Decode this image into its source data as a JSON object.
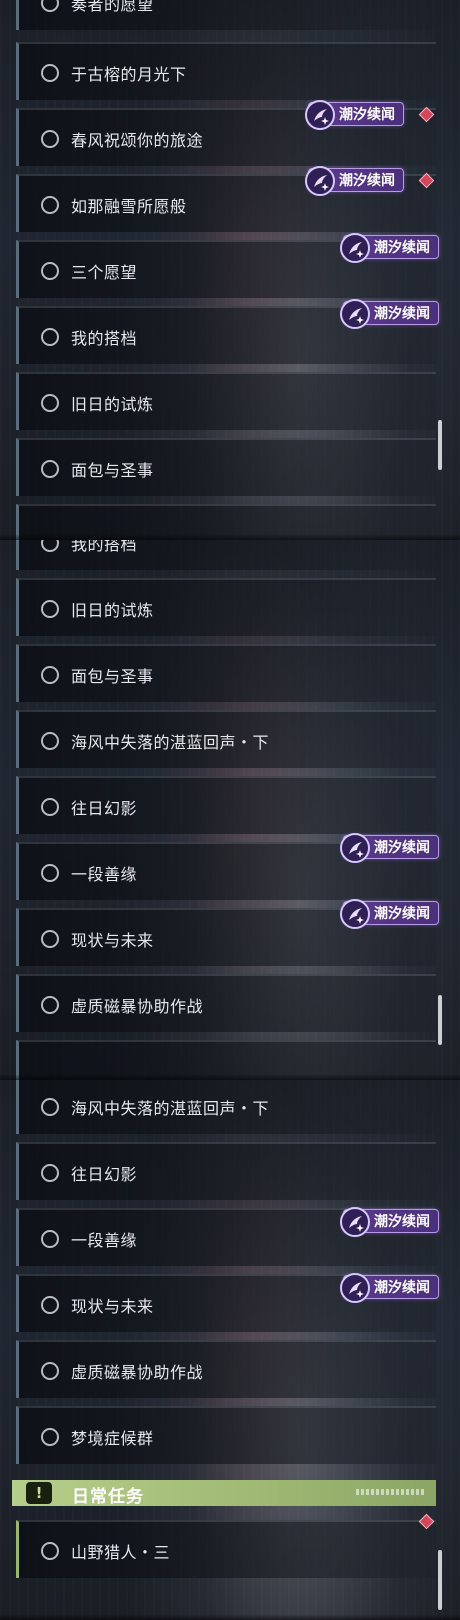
{
  "badge_text": "潮汐续闻",
  "colors": {
    "badge_bg": "#4a2f7a",
    "alert_diamond": "#d4465a",
    "daily_section": "#b5cf8a",
    "row_accent": "#5b6d7c"
  },
  "icons": [
    "circle-status-icon",
    "tide-story-icon",
    "alert-diamond-icon",
    "exclamation-icon"
  ],
  "panel1": {
    "items": [
      {
        "label": "奏者的愿望"
      },
      {
        "label": "于古榕的月光下"
      },
      {
        "label": "春风祝颂你的旅途"
      },
      {
        "label": "如那融雪所愿般"
      },
      {
        "label": "三个愿望"
      },
      {
        "label": "我的搭档"
      },
      {
        "label": "旧日的试炼"
      },
      {
        "label": "面包与圣事"
      }
    ]
  },
  "panel2": {
    "items": [
      {
        "label": "我的搭档"
      },
      {
        "label": "旧日的试炼"
      },
      {
        "label": "面包与圣事"
      },
      {
        "label": "海风中失落的湛蓝回声・下"
      },
      {
        "label": "往日幻影"
      },
      {
        "label": "一段善缘"
      },
      {
        "label": "现状与未来"
      },
      {
        "label": "虚质磁暴协助作战"
      }
    ]
  },
  "panel3": {
    "items": [
      {
        "label": "海风中失落的湛蓝回声・下"
      },
      {
        "label": "往日幻影"
      },
      {
        "label": "一段善缘"
      },
      {
        "label": "现状与未来"
      },
      {
        "label": "虚质磁暴协助作战"
      },
      {
        "label": "梦境症候群"
      }
    ],
    "section": {
      "icon_text": "!",
      "title": "日常任务"
    },
    "daily_items": [
      {
        "label": "山野猎人・三"
      }
    ]
  }
}
